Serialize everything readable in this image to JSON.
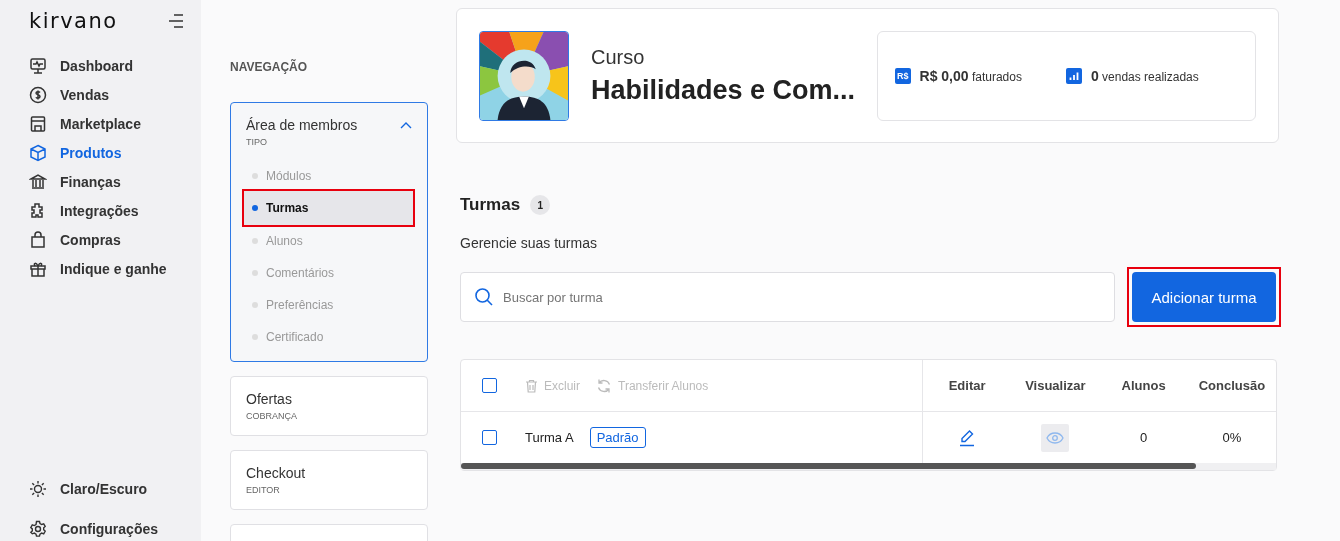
{
  "sidebar": {
    "logo": "kirvano",
    "items": [
      {
        "label": "Dashboard",
        "selected": false
      },
      {
        "label": "Vendas",
        "selected": false
      },
      {
        "label": "Marketplace",
        "selected": false
      },
      {
        "label": "Produtos",
        "selected": true
      },
      {
        "label": "Finanças",
        "selected": false
      },
      {
        "label": "Integrações",
        "selected": false
      },
      {
        "label": "Compras",
        "selected": false
      },
      {
        "label": "Indique e ganhe",
        "selected": false
      }
    ],
    "footer": [
      {
        "label": "Claro/Escuro"
      },
      {
        "label": "Configurações"
      }
    ]
  },
  "navigation": {
    "heading": "NAVEGAÇÃO",
    "sections": [
      {
        "kind": "menu",
        "title": "Área de membros",
        "subtitle": "TIPO",
        "expanded": true,
        "items": [
          {
            "label": "Módulos",
            "selected": false,
            "highlighted": false
          },
          {
            "label": "Turmas",
            "selected": true,
            "highlighted": true
          },
          {
            "label": "Alunos",
            "selected": false,
            "highlighted": false
          },
          {
            "label": "Comentários",
            "selected": false,
            "highlighted": false
          },
          {
            "label": "Preferências",
            "selected": false,
            "highlighted": false
          },
          {
            "label": "Certificado",
            "selected": false,
            "highlighted": false
          }
        ]
      },
      {
        "kind": "menu",
        "title": "Ofertas",
        "subtitle": "COBRANÇA",
        "expanded": false
      },
      {
        "kind": "menu",
        "title": "Checkout",
        "subtitle": "EDITOR",
        "expanded": false
      },
      {
        "kind": "empty"
      }
    ]
  },
  "product": {
    "type": "Curso",
    "name": "Habilidades e Com...",
    "stats": [
      {
        "icon_text": "R$",
        "value": "R$ 0,00",
        "label": "faturados"
      },
      {
        "value": "0",
        "label": "vendas realizadas"
      }
    ]
  },
  "classes": {
    "title": "Turmas",
    "count": "1",
    "subtitle": "Gerencie suas turmas",
    "search": {
      "placeholder": "Buscar por turma"
    },
    "add_button": {
      "label": "Adicionar turma",
      "highlighted": true
    },
    "table": {
      "all_checked": false,
      "actions": [
        {
          "label": "Excluir",
          "disabled": true
        },
        {
          "label": "Transferir Alunos",
          "disabled": true
        }
      ],
      "columns": [
        "Editar",
        "Visualizar",
        "Alunos",
        "Conclusão"
      ],
      "rows": [
        {
          "name": "Turma A",
          "badge": "Padrão",
          "checked": false,
          "students": "0",
          "completion": "0%"
        }
      ]
    }
  }
}
